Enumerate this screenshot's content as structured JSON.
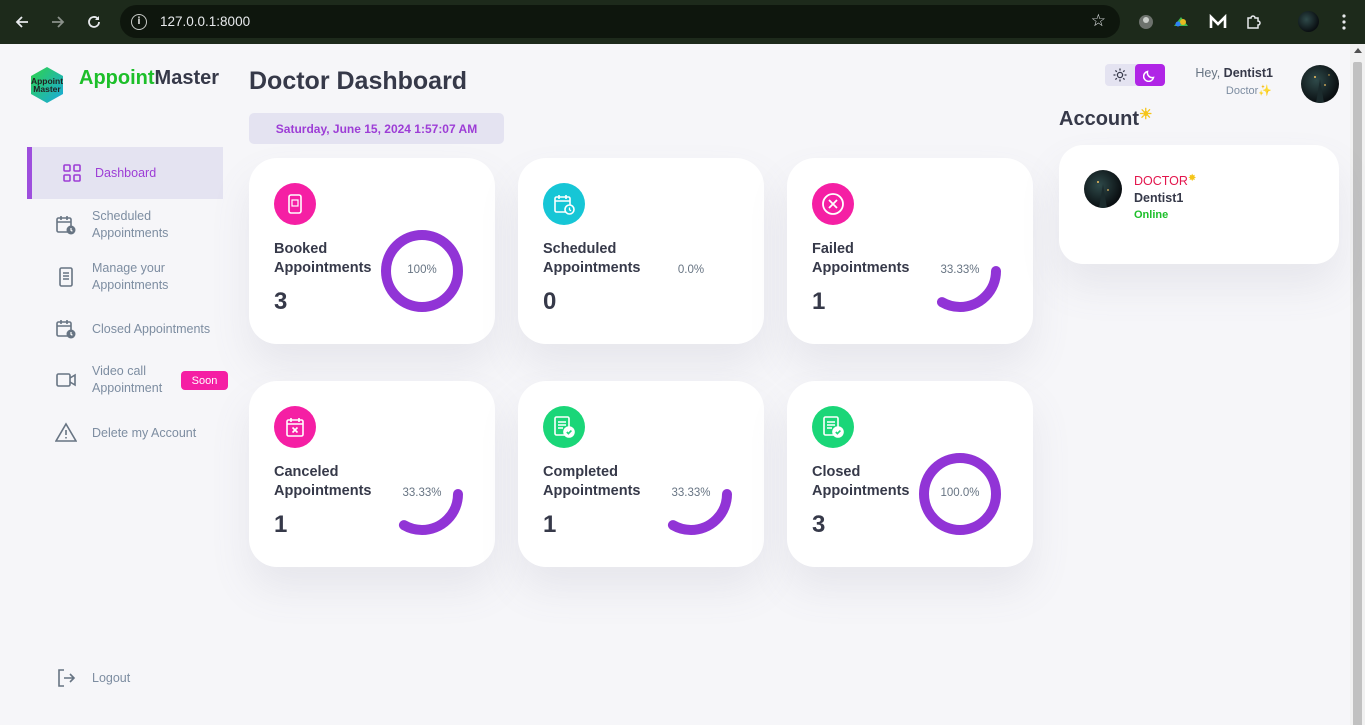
{
  "browser": {
    "url": "127.0.0.1:8000"
  },
  "sidebar": {
    "brand_green": "Appoint",
    "brand_rest": "Master",
    "logo_text_1": "Appoint",
    "logo_text_2": "Master",
    "items": [
      {
        "label": "Dashboard",
        "icon": "grid-icon",
        "active": true
      },
      {
        "label": "Scheduled Appointments",
        "icon": "calendar-clock-icon"
      },
      {
        "label": "Manage your Appointments",
        "icon": "document-icon"
      },
      {
        "label": "Closed Appointments",
        "icon": "calendar-clock-icon"
      },
      {
        "label": "Video call Appointment",
        "icon": "video-icon",
        "badge": "Soon"
      },
      {
        "label": "Delete my Account",
        "icon": "warning-icon"
      }
    ],
    "logout": "Logout"
  },
  "main": {
    "title": "Doctor Dashboard",
    "date": "Saturday, June 15, 2024 1:57:07 AM",
    "cards": [
      {
        "label1": "Booked",
        "label2": "Appointments",
        "value": "3",
        "percent_label": "100%",
        "percent": 100,
        "icon_color": "#f51fa4",
        "icon": "phone-icon"
      },
      {
        "label1": "Scheduled",
        "label2": "Appointments",
        "value": "0",
        "percent_label": "0.0%",
        "percent": 0,
        "icon_color": "#16c6d6",
        "icon": "calendar-clock-icon"
      },
      {
        "label1": "Failed",
        "label2": "Appointments",
        "value": "1",
        "percent_label": "33.33%",
        "percent": 33.33,
        "icon_color": "#f51fa4",
        "icon": "close-circle-icon"
      },
      {
        "label1": "Canceled",
        "label2": "Appointments",
        "value": "1",
        "percent_label": "33.33%",
        "percent": 33.33,
        "icon_color": "#f51fa4",
        "icon": "calendar-x-icon"
      },
      {
        "label1": "Completed",
        "label2": "Appointments",
        "value": "1",
        "percent_label": "33.33%",
        "percent": 33.33,
        "icon_color": "#1ad678",
        "icon": "checklist-icon"
      },
      {
        "label1": "Closed",
        "label2": "Appointments",
        "value": "3",
        "percent_label": "100.0%",
        "percent": 100,
        "icon_color": "#1ad678",
        "icon": "checklist-icon"
      }
    ]
  },
  "header": {
    "greeting": "Hey,",
    "username": "Dentist1",
    "role": "Doctor"
  },
  "account": {
    "title": "Account",
    "role": "DOCTOR",
    "name": "Dentist1",
    "status": "Online"
  },
  "colors": {
    "accent": "#9d3dd6",
    "ring": "#9134d6",
    "online": "#1dbf2a"
  }
}
